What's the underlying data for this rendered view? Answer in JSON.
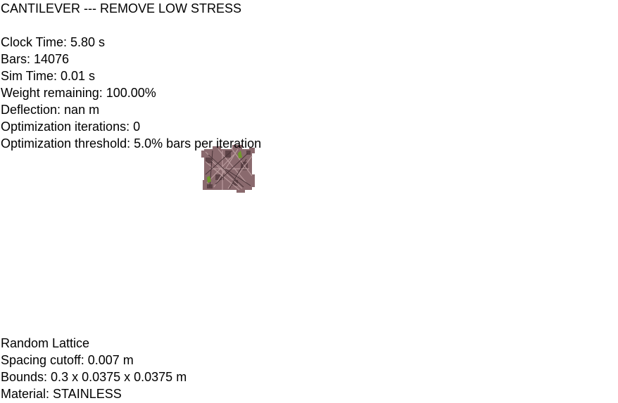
{
  "title": "CANTILEVER --- REMOVE LOW STRESS",
  "stats": {
    "clock_time": "Clock Time: 5.80 s",
    "bars": "Bars: 14076",
    "sim_time": "Sim Time: 0.01 s",
    "weight_remaining": "Weight remaining: 100.00%",
    "deflection": "Deflection: nan m",
    "optimization_iterations": "Optimization iterations: 0",
    "optimization_threshold": "Optimization threshold: 5.0% bars per iteration"
  },
  "lattice_info": {
    "type": "Random Lattice",
    "spacing_cutoff": "Spacing cutoff: 0.007 m",
    "bounds": "Bounds: 0.3 x 0.0375 x 0.0375 m",
    "material": "Material: STAINLESS"
  },
  "colors": {
    "bar_color": "#8a6a6e",
    "bar_dark": "#5e4448",
    "bar_light": "#b89a9c",
    "support_marker": "#6f9a2a"
  }
}
